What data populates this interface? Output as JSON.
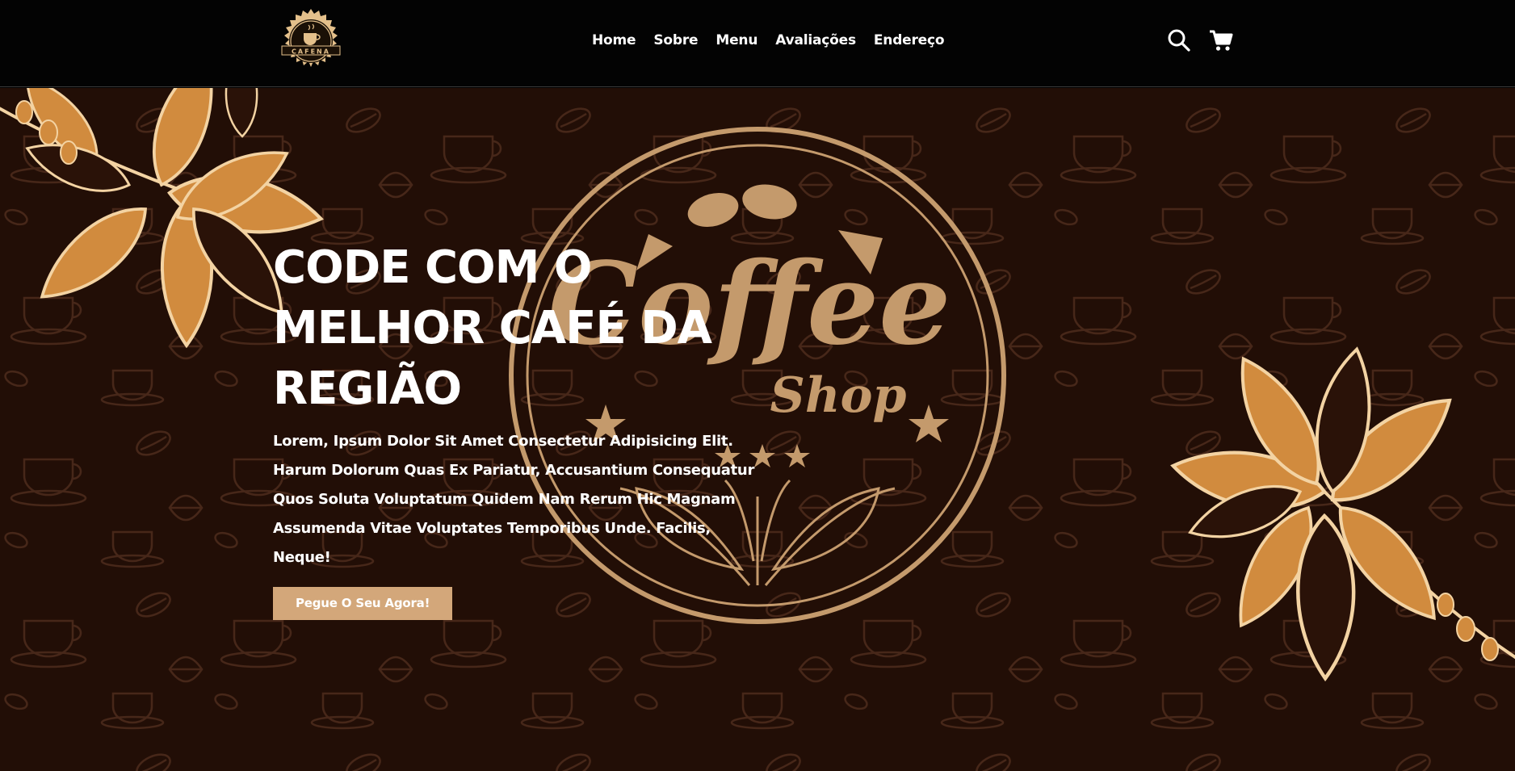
{
  "header": {
    "logo_text": "CAFENA",
    "nav": [
      {
        "label": "Home"
      },
      {
        "label": "Sobre"
      },
      {
        "label": "Menu"
      },
      {
        "label": "Avaliações"
      },
      {
        "label": "Endereço"
      }
    ],
    "icons": [
      "search-icon",
      "cart-icon"
    ]
  },
  "hero": {
    "title": "CODE COM O MELHOR CAFÉ DA REGIÃO",
    "text": "Lorem, Ipsum Dolor Sit Amet Consectetur Adipisicing Elit. Harum Dolorum Quas Ex Pariatur, Accusantium Consequatur Quos Soluta Voluptatum Quidem Nam Rerum Hic Magnam Assumenda Vitae Voluptates Temporibus Unde. Facilis, Neque!",
    "cta_label": "Pegue O Seu Agora!",
    "emblem": {
      "word": "Coffee",
      "sub": "Shop"
    }
  },
  "colors": {
    "header_bg": "#030303",
    "hero_bg": "#220e06",
    "accent": "#d3a77a",
    "emblem": "#c49a6c",
    "leaf_orange": "#d18b3e",
    "leaf_light": "#f3d3a3"
  }
}
